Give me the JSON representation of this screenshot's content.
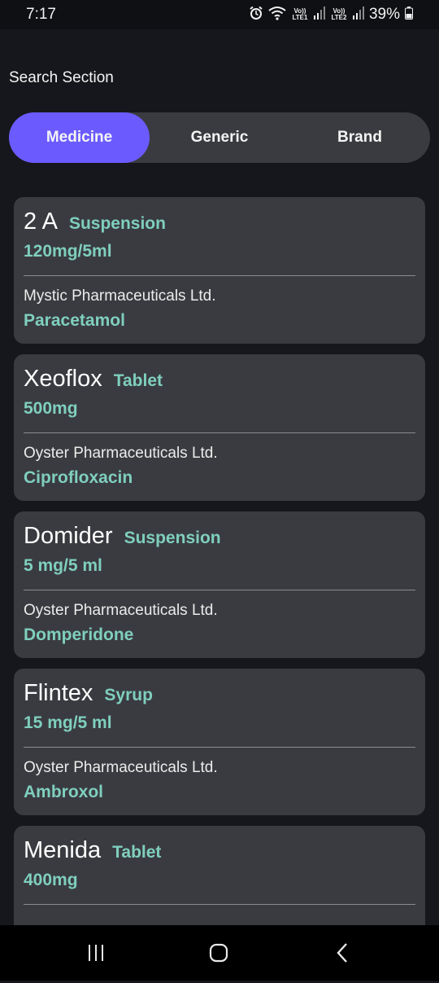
{
  "status_bar": {
    "time": "7:17",
    "lte1": "Vo)) LTE1",
    "lte2": "Vo)) LTE2",
    "battery": "39%",
    "icons": [
      "alarm-icon",
      "wifi-icon",
      "signal-icon",
      "signal-icon",
      "battery-icon"
    ]
  },
  "section_title": "Search Section",
  "tabs": [
    {
      "label": "Medicine",
      "active": true
    },
    {
      "label": "Generic",
      "active": false
    },
    {
      "label": "Brand",
      "active": false
    }
  ],
  "medicines": [
    {
      "name": "2 A",
      "form": "Suspension",
      "strength": "120mg/5ml",
      "company": "Mystic Pharmaceuticals Ltd.",
      "generic": "Paracetamol"
    },
    {
      "name": "Xeoflox",
      "form": "Tablet",
      "strength": "500mg",
      "company": "Oyster Pharmaceuticals Ltd.",
      "generic": "Ciprofloxacin"
    },
    {
      "name": "Domider",
      "form": "Suspension",
      "strength": "5 mg/5 ml",
      "company": "Oyster Pharmaceuticals Ltd.",
      "generic": "Domperidone"
    },
    {
      "name": "Flintex",
      "form": "Syrup",
      "strength": "15 mg/5 ml",
      "company": "Oyster Pharmaceuticals Ltd.",
      "generic": "Ambroxol"
    },
    {
      "name": "Menida",
      "form": "Tablet",
      "strength": "400mg",
      "company": "",
      "generic": ""
    }
  ],
  "nav_bar": {
    "icons": [
      "recents-icon",
      "home-icon",
      "back-icon"
    ]
  },
  "colors": {
    "accent": "#6b5bff",
    "teal": "#7fcfbe",
    "card": "#3a3b40",
    "background": "#16171c"
  }
}
